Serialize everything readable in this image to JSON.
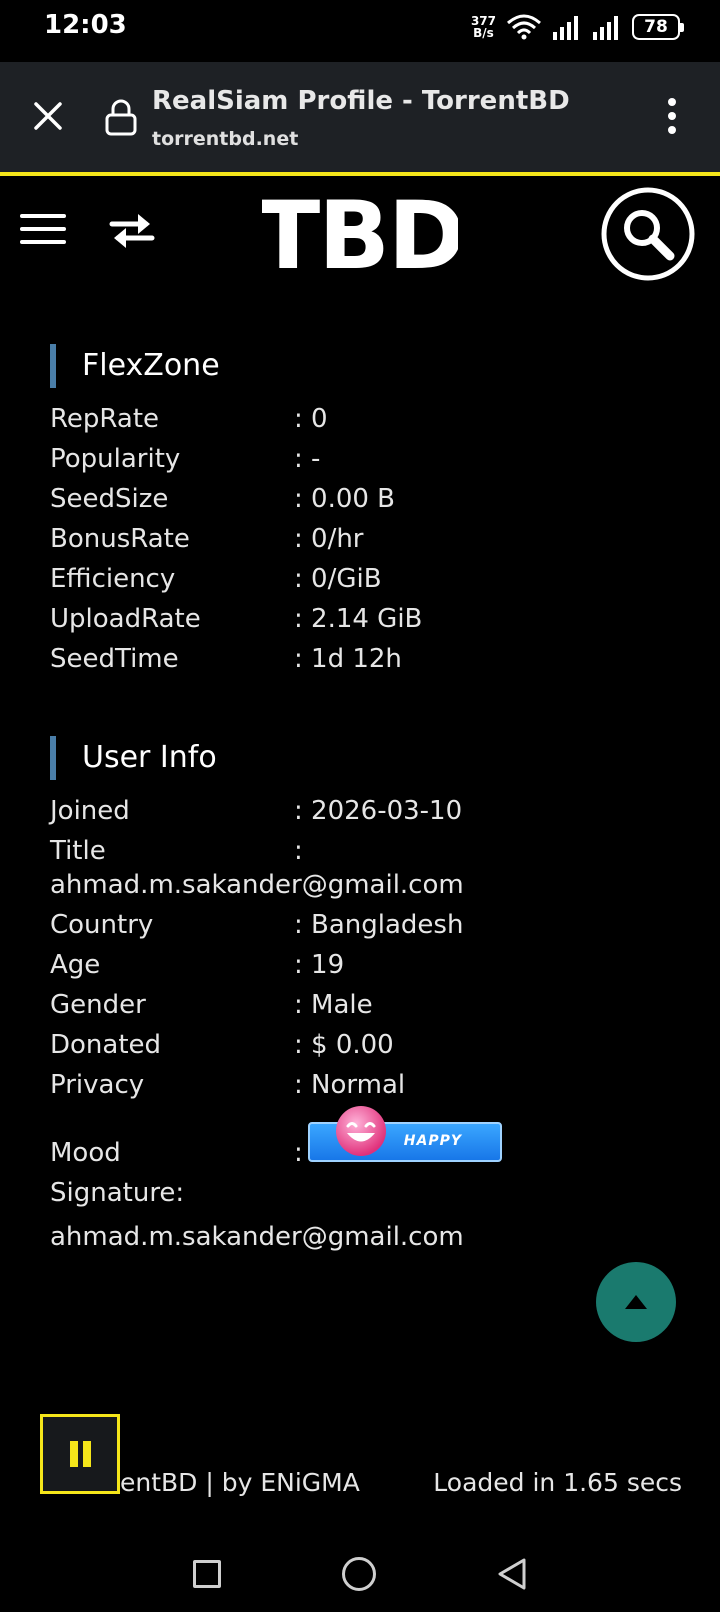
{
  "status_bar": {
    "time": "12:03",
    "net_speed_value": "377",
    "net_speed_unit": "B/s",
    "battery": "78"
  },
  "browser": {
    "title": "RealSiam Profile - TorrentBD",
    "url": "torrentbd.net"
  },
  "header": {
    "logo_text": "TBD"
  },
  "flexzone": {
    "title": "FlexZone",
    "rows": [
      {
        "label": "RepRate",
        "value": ": 0"
      },
      {
        "label": "Popularity",
        "value": ": -"
      },
      {
        "label": "SeedSize",
        "value": ": 0.00 B"
      },
      {
        "label": "BonusRate",
        "value": ": 0/hr"
      },
      {
        "label": "Efficiency",
        "value": ": 0/GiB"
      },
      {
        "label": "UploadRate",
        "value": ": 2.14 GiB"
      },
      {
        "label": "SeedTime",
        "value": ": 1d 12h"
      }
    ]
  },
  "user_info": {
    "title": "User Info",
    "joined": {
      "label": "Joined",
      "value": ": 2026-03-10"
    },
    "title_row": {
      "label": "Title",
      "value": ":",
      "value_wrapped": "ahmad.m.sakander@gmail.com"
    },
    "rows": [
      {
        "label": "Country",
        "value": ": Bangladesh"
      },
      {
        "label": "Age",
        "value": ": 19"
      },
      {
        "label": "Gender",
        "value": ": Male"
      },
      {
        "label": "Donated",
        "value": ": $ 0.00"
      },
      {
        "label": "Privacy",
        "value": ": Normal"
      }
    ],
    "mood": {
      "label": "Mood",
      "value": ":",
      "badge_text": "HAPPY"
    },
    "signature": {
      "label": "Signature:",
      "value": "ahmad.m.sakander@gmail.com"
    }
  },
  "footer": {
    "left": "entBD | by ENiGMA",
    "right": "Loaded in 1.65 secs"
  },
  "colors": {
    "accent_yellow": "#f5e61a",
    "section_bar": "#4a7ea8",
    "scroll_top_bg": "#1a7a6e",
    "mood_badge": "#1877e8"
  }
}
